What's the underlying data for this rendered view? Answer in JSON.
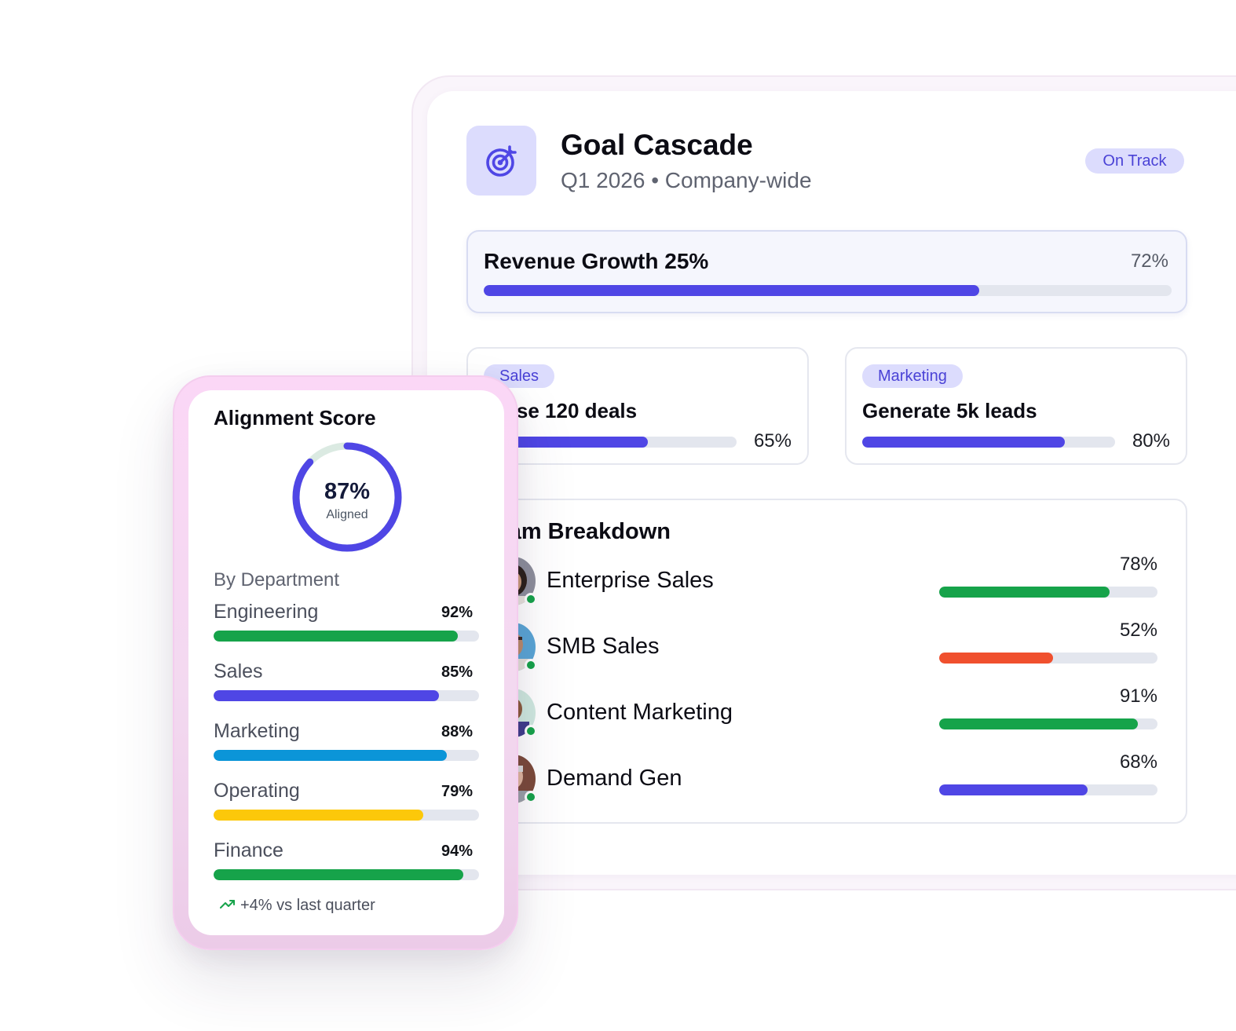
{
  "colors": {
    "indigo": "#4f46e5",
    "green": "#16a34a",
    "red": "#f0502e",
    "blue": "#0b95d8",
    "yellow": "#fcc80a",
    "badge_bg": "#dcdcfd"
  },
  "goal": {
    "icon": "target-icon",
    "title": "Goal Cascade",
    "subtitle": "Q1 2026 • Company-wide",
    "status": "On Track"
  },
  "revenue": {
    "title": "Revenue Growth 25%",
    "pct_label": "72%",
    "progress": 72
  },
  "sub_goals": [
    {
      "tag": "Sales",
      "title": "Close 120 deals",
      "pct_label": "65%",
      "progress": 65
    },
    {
      "tag": "Marketing",
      "title": "Generate 5k leads",
      "pct_label": "80%",
      "progress": 80
    }
  ],
  "team": {
    "title": "Team Breakdown",
    "rows": [
      {
        "name": "Enterprise Sales",
        "pct_label": "78%",
        "progress": 78,
        "color": "#16a34a"
      },
      {
        "name": "SMB Sales",
        "pct_label": "52%",
        "progress": 52,
        "color": "#f0502e"
      },
      {
        "name": "Content Marketing",
        "pct_label": "91%",
        "progress": 91,
        "color": "#16a34a"
      },
      {
        "name": "Demand Gen",
        "pct_label": "68%",
        "progress": 68,
        "color": "#4f46e5"
      }
    ]
  },
  "alignment": {
    "title": "Alignment Score",
    "value_label": "87%",
    "value": 87,
    "sublabel": "Aligned",
    "dept_heading": "By Department",
    "departments": [
      {
        "name": "Engineering",
        "pct_label": "92%",
        "progress": 92,
        "color": "#16a34a"
      },
      {
        "name": "Sales",
        "pct_label": "85%",
        "progress": 85,
        "color": "#4f46e5"
      },
      {
        "name": "Marketing",
        "pct_label": "88%",
        "progress": 88,
        "color": "#0b95d8"
      },
      {
        "name": "Operating",
        "pct_label": "79%",
        "progress": 79,
        "color": "#fcc80a"
      },
      {
        "name": "Finance",
        "pct_label": "94%",
        "progress": 94,
        "color": "#16a34a"
      }
    ],
    "trend_icon": "trending-up-icon",
    "trend_text": "+4% vs last quarter"
  }
}
